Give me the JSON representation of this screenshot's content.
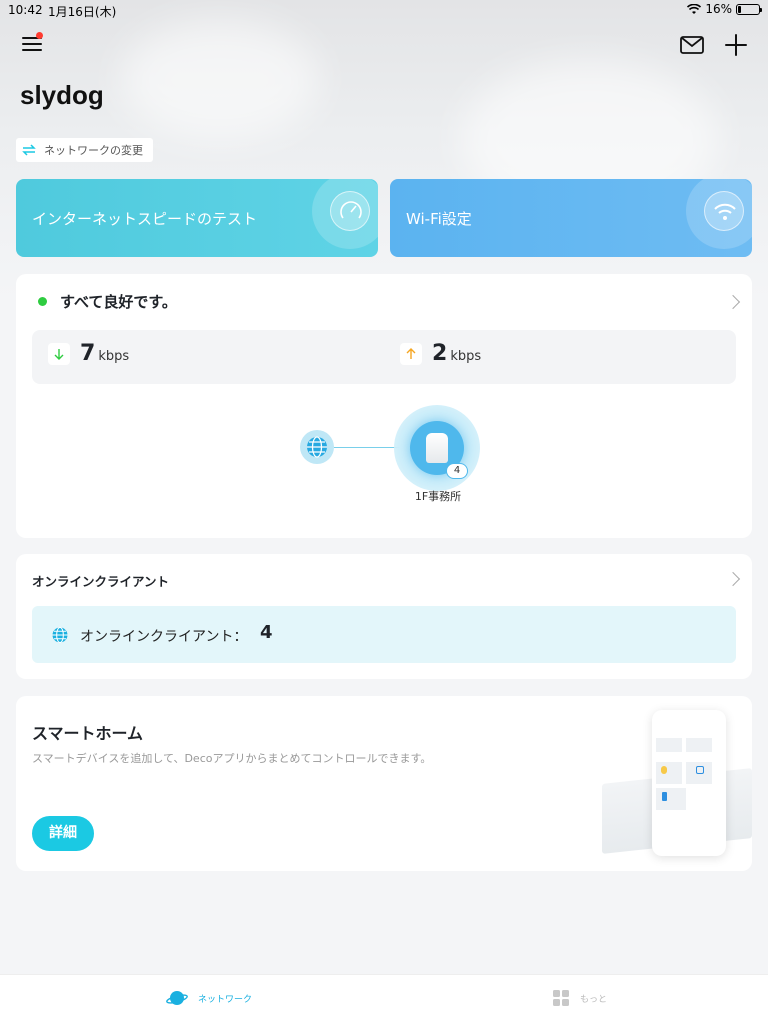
{
  "status_bar": {
    "time": "10:42",
    "date": "1月16日(木)",
    "battery": "16%",
    "battery_level": 0.16
  },
  "header": {
    "title": "slydog",
    "network_change_label": "ネットワークの変更"
  },
  "tiles": {
    "speed_test": "インターネットスピードのテスト",
    "wifi_settings": "Wi-Fi設定"
  },
  "status_card": {
    "status_text": "すべて良好です。",
    "download": {
      "value": "7",
      "unit": "kbps"
    },
    "upload": {
      "value": "2",
      "unit": "kbps"
    },
    "deco": {
      "name": "1F事務所",
      "client_count": "4"
    }
  },
  "clients_card": {
    "title": "オンラインクライアント",
    "label": "オンラインクライアント：",
    "count": "4"
  },
  "smart_home": {
    "title": "スマートホーム",
    "description": "スマートデバイスを追加して、Decoアプリからまとめてコントロールできます。",
    "button": "詳細"
  },
  "tab_bar": {
    "network": "ネットワーク",
    "more": "もっと"
  },
  "colors": {
    "accent": "#1bc9e3",
    "speed_tile": "#4fcadd",
    "wifi_tile": "#5bb3f0",
    "status_ok": "#2ecc40"
  },
  "icons": [
    "menu-icon",
    "notification-dot",
    "mail-icon",
    "plus-icon",
    "swap-icon",
    "speedometer-icon",
    "wifi-icon",
    "chevron-right-icon",
    "download-arrow-icon",
    "upload-arrow-icon",
    "globe-icon",
    "deco-unit-icon",
    "planet-icon",
    "grid-icon"
  ]
}
